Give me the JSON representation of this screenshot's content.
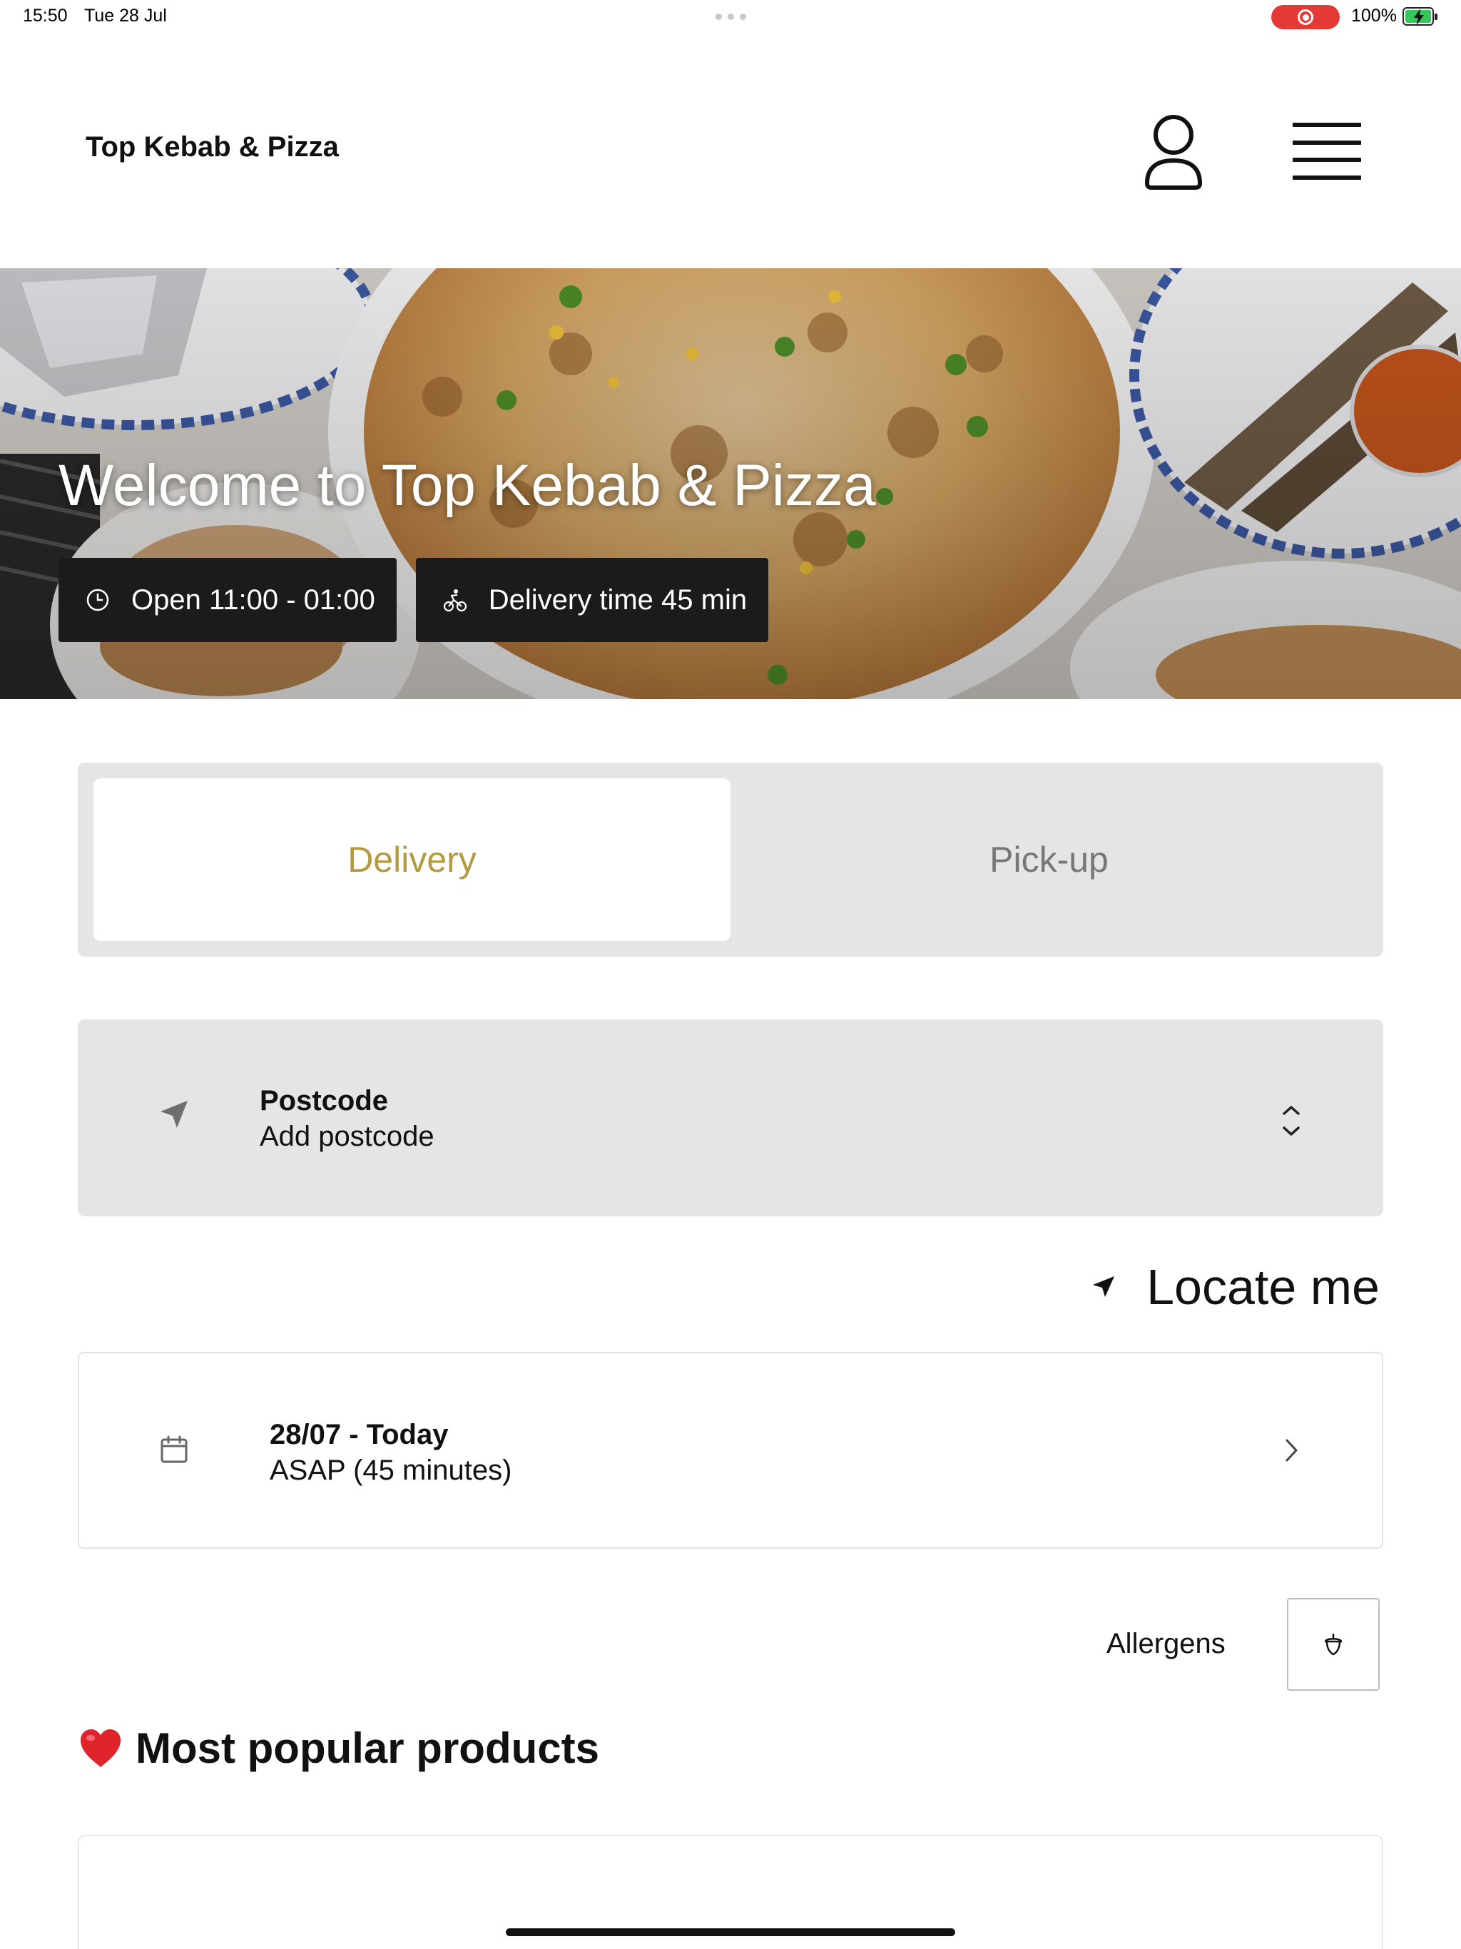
{
  "status_bar": {
    "time": "15:50",
    "date": "Tue 28 Jul",
    "battery": "100%",
    "record_color": "#e53935"
  },
  "header": {
    "brand": "Top Kebab & Pizza",
    "account_icon": "person-icon",
    "menu_icon": "hamburger-menu-icon"
  },
  "hero": {
    "title": "Welcome to Top Kebab & Pizza",
    "open_hours": "Open 11:00 - 01:00",
    "delivery_time": "Delivery time 45 min",
    "open_icon": "clock-icon",
    "delivery_icon": "cyclist-icon"
  },
  "order_type": {
    "options": [
      "Delivery",
      "Pick-up"
    ],
    "selected": "Delivery",
    "accent_color": "#b49a3e"
  },
  "postcode": {
    "title": "Postcode",
    "placeholder": "Add postcode",
    "icon": "location-arrow-icon"
  },
  "locate": {
    "label": "Locate me",
    "icon": "location-arrow-icon"
  },
  "schedule": {
    "date": "28/07 - Today",
    "time": "ASAP (45 minutes)",
    "icon": "calendar-icon"
  },
  "allergens": {
    "label": "Allergens",
    "icon": "acorn-icon"
  },
  "popular": {
    "emoji": "❤️",
    "title": "Most popular products"
  }
}
